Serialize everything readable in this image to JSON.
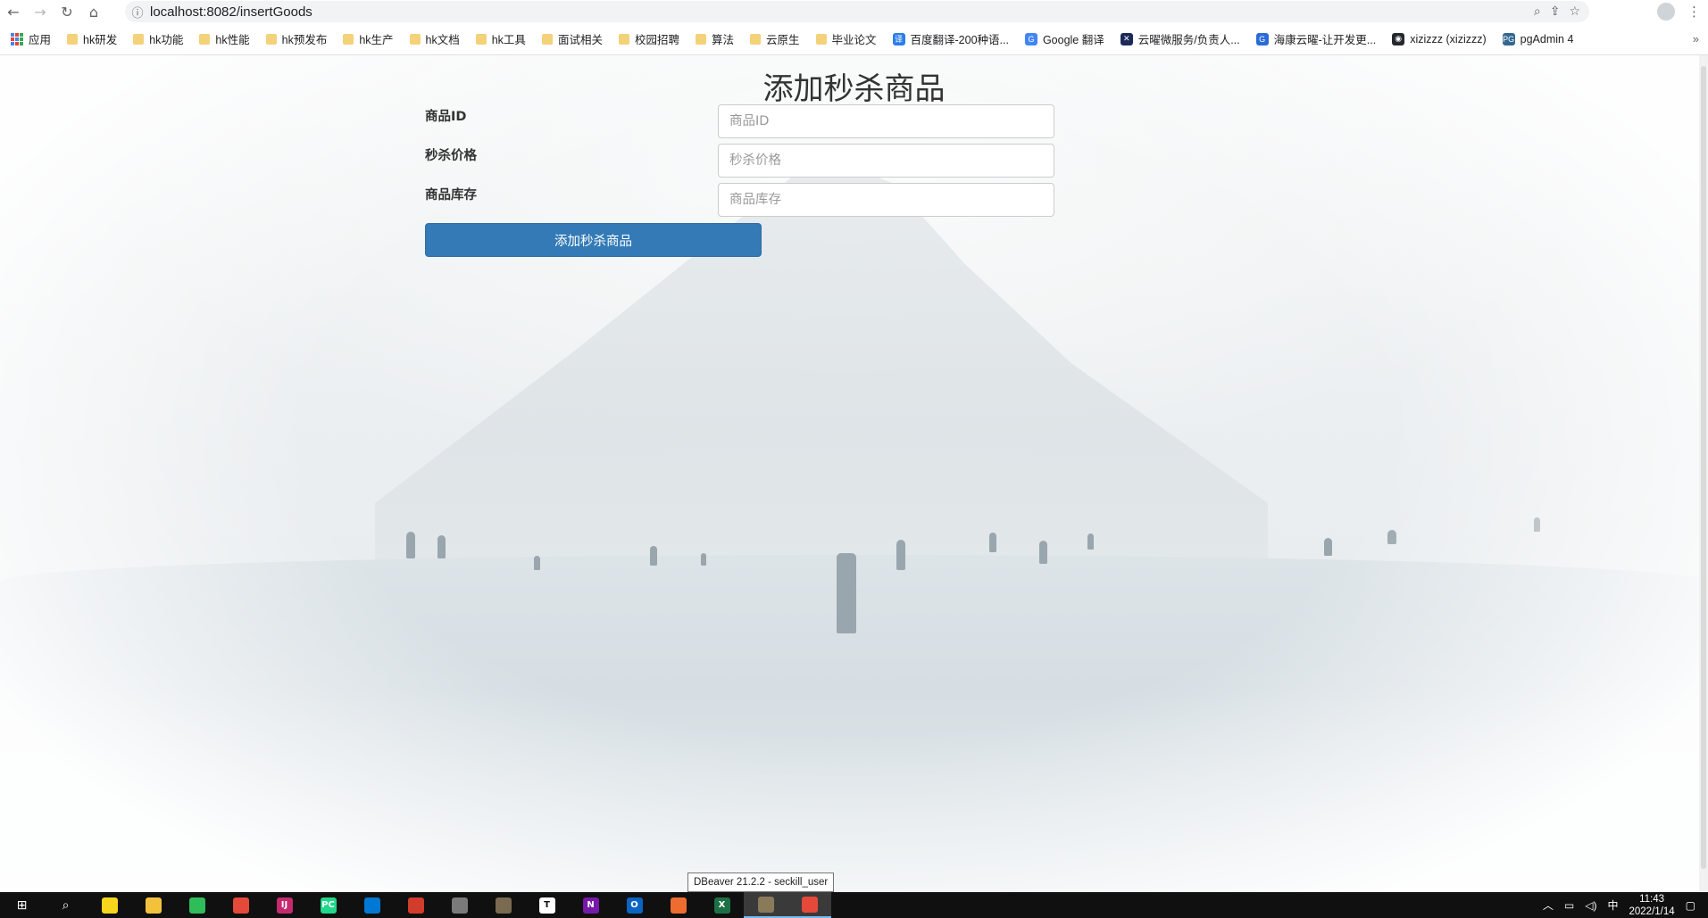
{
  "browser": {
    "url": "localhost:8082/insertGoods",
    "icons": {
      "back": "back-arrow-icon",
      "forward": "forward-arrow-icon",
      "reload": "reload-icon",
      "home": "home-icon",
      "info": "info-icon",
      "zoom": "zoom-icon",
      "share": "share-icon",
      "star": "star-icon",
      "profile": "profile-icon",
      "menu": "kebab-menu-icon"
    }
  },
  "bookmarks": [
    {
      "label": "应用",
      "type": "apps"
    },
    {
      "label": "hk研发",
      "type": "folder"
    },
    {
      "label": "hk功能",
      "type": "folder"
    },
    {
      "label": "hk性能",
      "type": "folder"
    },
    {
      "label": "hk预发布",
      "type": "folder"
    },
    {
      "label": "hk生产",
      "type": "folder"
    },
    {
      "label": "hk文档",
      "type": "folder"
    },
    {
      "label": "hk工具",
      "type": "folder"
    },
    {
      "label": "面试相关",
      "type": "folder"
    },
    {
      "label": "校园招聘",
      "type": "folder"
    },
    {
      "label": "算法",
      "type": "folder"
    },
    {
      "label": "云原生",
      "type": "folder"
    },
    {
      "label": "毕业论文",
      "type": "folder"
    },
    {
      "label": "百度翻译-200种语...",
      "type": "site",
      "color": "#2b7de9",
      "glyph": "译"
    },
    {
      "label": "Google 翻译",
      "type": "site",
      "color": "#4285f4",
      "glyph": "G"
    },
    {
      "label": "云曜微服务/负责人...",
      "type": "site",
      "color": "#1c2a5a",
      "glyph": "✕"
    },
    {
      "label": "海康云曜-让开发更...",
      "type": "site",
      "color": "#2c6bd6",
      "glyph": "G"
    },
    {
      "label": "xizizzz (xizizzz)",
      "type": "site",
      "color": "#24292e",
      "glyph": "◉"
    },
    {
      "label": "pgAdmin 4",
      "type": "site",
      "color": "#336791",
      "glyph": "PG"
    }
  ],
  "form": {
    "title": "添加秒杀商品",
    "fields": [
      {
        "label": "商品ID",
        "placeholder": "商品ID",
        "value": ""
      },
      {
        "label": "秒杀价格",
        "placeholder": "秒杀价格",
        "value": ""
      },
      {
        "label": "商品库存",
        "placeholder": "商品库存",
        "value": ""
      }
    ],
    "submit_label": "添加秒杀商品"
  },
  "tooltip": "DBeaver 21.2.2 - seckill_user",
  "taskbar": {
    "apps": [
      {
        "name": "start-icon",
        "color": "#ffffff",
        "glyph": "⊞"
      },
      {
        "name": "search-icon",
        "color": "#ffffff",
        "glyph": "⌕"
      },
      {
        "name": "sticky-notes-icon",
        "color": "#f7d51d",
        "glyph": ""
      },
      {
        "name": "file-explorer-icon",
        "color": "#f3c23d",
        "glyph": ""
      },
      {
        "name": "app-green-icon",
        "color": "#2ebd59",
        "glyph": ""
      },
      {
        "name": "chrome-icon",
        "color": "#e5493a",
        "glyph": ""
      },
      {
        "name": "intellij-icon",
        "color": "#c62a6e",
        "glyph": "IJ"
      },
      {
        "name": "pycharm-icon",
        "color": "#21d789",
        "glyph": "PC"
      },
      {
        "name": "vscode-icon",
        "color": "#0078d4",
        "glyph": ""
      },
      {
        "name": "app-red-icon",
        "color": "#d23c2b",
        "glyph": ""
      },
      {
        "name": "app-gray-icon",
        "color": "#7a7a7a",
        "glyph": ""
      },
      {
        "name": "dbeaver-icon",
        "color": "#7a6a4f",
        "glyph": ""
      },
      {
        "name": "typora-icon",
        "color": "#ffffff",
        "glyph": "T"
      },
      {
        "name": "onenote-icon",
        "color": "#7719aa",
        "glyph": "N"
      },
      {
        "name": "outlook-icon",
        "color": "#0a64c4",
        "glyph": "O"
      },
      {
        "name": "postman-icon",
        "color": "#ef6c2f",
        "glyph": ""
      },
      {
        "name": "excel-icon",
        "color": "#1d7044",
        "glyph": "X"
      },
      {
        "name": "dbeaver-active-icon",
        "color": "#8b7a5a",
        "glyph": ""
      },
      {
        "name": "chrome-active-icon",
        "color": "#e5493a",
        "glyph": ""
      }
    ],
    "tray": {
      "ime": "中",
      "time": "11:43",
      "date": "2022/1/14"
    }
  }
}
